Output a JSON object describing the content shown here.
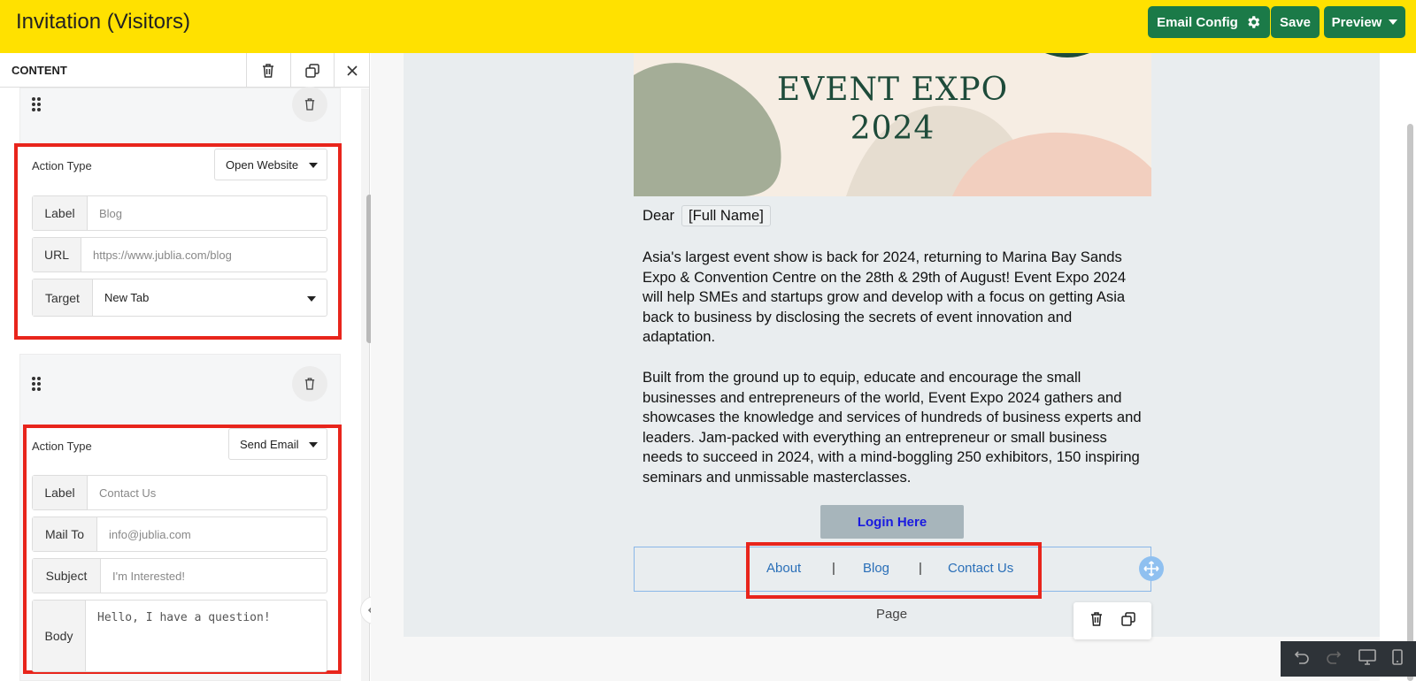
{
  "header": {
    "title": "Invitation (Visitors)",
    "email_config_label": "Email Config",
    "save_label": "Save",
    "preview_label": "Preview"
  },
  "panel": {
    "title": "CONTENT",
    "actions": [
      {
        "action_type_label": "Action Type",
        "action_type_value": "Open Website",
        "fields": [
          {
            "label": "Label",
            "value": "Blog"
          },
          {
            "label": "URL",
            "value": "https://www.jublia.com/blog"
          },
          {
            "label": "Target",
            "value": "New Tab"
          }
        ]
      },
      {
        "action_type_label": "Action Type",
        "action_type_value": "Send Email",
        "fields": [
          {
            "label": "Label",
            "value": "Contact Us"
          },
          {
            "label": "Mail To",
            "value": "info@jublia.com"
          },
          {
            "label": "Subject",
            "value": "I'm Interested!"
          },
          {
            "label": "Body",
            "value": "Hello, I have a question!"
          }
        ]
      }
    ]
  },
  "email": {
    "banner_title_line1": "EVENT EXPO",
    "banner_title_line2": "2024",
    "dear": "Dear",
    "full_name_tag": "[Full Name]",
    "paragraph1": "Asia's largest event show is back for 2024, returning to Marina Bay Sands Expo & Convention Centre on the 28th & 29th of August! Event Expo 2024 will help SMEs and startups grow and develop with a focus on getting Asia back to business by disclosing the secrets of event innovation and adaptation.",
    "paragraph2": "Built from the ground up to equip, educate and encourage the small businesses and entrepreneurs of the world, Event Expo 2024 gathers and showcases the knowledge and services of hundreds of business experts and leaders. Jam-packed with everything an entrepreneur or small business needs to succeed in 2024, with a mind-boggling 250 exhibitors, 150 inspiring seminars and unmissable masterclasses.",
    "login_button": "Login Here",
    "menu": [
      "About",
      "Blog",
      "Contact Us"
    ],
    "separator": "|",
    "page_label": "Page"
  },
  "colors": {
    "header_bg": "#ffe100",
    "primary_button": "#1b7a48",
    "highlight": "#e8251c",
    "link": "#2a6fb8"
  },
  "icons": [
    "gear-icon",
    "caret-down-icon",
    "trash-icon",
    "duplicate-icon",
    "close-icon",
    "drag-handle-icon",
    "collapse-left-icon",
    "move-icon",
    "undo-icon",
    "redo-icon",
    "desktop-icon",
    "mobile-icon"
  ]
}
